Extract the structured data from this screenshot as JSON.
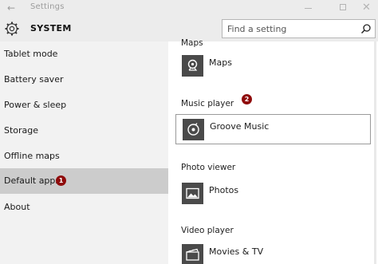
{
  "window": {
    "title": "Settings"
  },
  "header": {
    "title": "SYSTEM",
    "search_placeholder": "Find a setting"
  },
  "sidebar": {
    "items": [
      {
        "label": "Tablet mode"
      },
      {
        "label": "Battery saver"
      },
      {
        "label": "Power & sleep"
      },
      {
        "label": "Storage"
      },
      {
        "label": "Offline maps"
      },
      {
        "label": "Default apps",
        "selected": true,
        "badge": "1"
      },
      {
        "label": "About"
      }
    ]
  },
  "main": {
    "sections": [
      {
        "heading": "Maps",
        "app": "Maps",
        "icon": "maps-icon"
      },
      {
        "heading": "Music player",
        "badge": "2",
        "app": "Groove Music",
        "icon": "groove-music-icon"
      },
      {
        "heading": "Photo viewer",
        "app": "Photos",
        "icon": "photos-icon"
      },
      {
        "heading": "Video player",
        "app": "Movies & TV",
        "icon": "movies-tv-icon"
      }
    ]
  },
  "colors": {
    "sidebar_bg": "#f2f2f2",
    "selected_bg": "#cccccc",
    "badge": "#8f0b0b",
    "app_tile": "#4a4a4a"
  }
}
